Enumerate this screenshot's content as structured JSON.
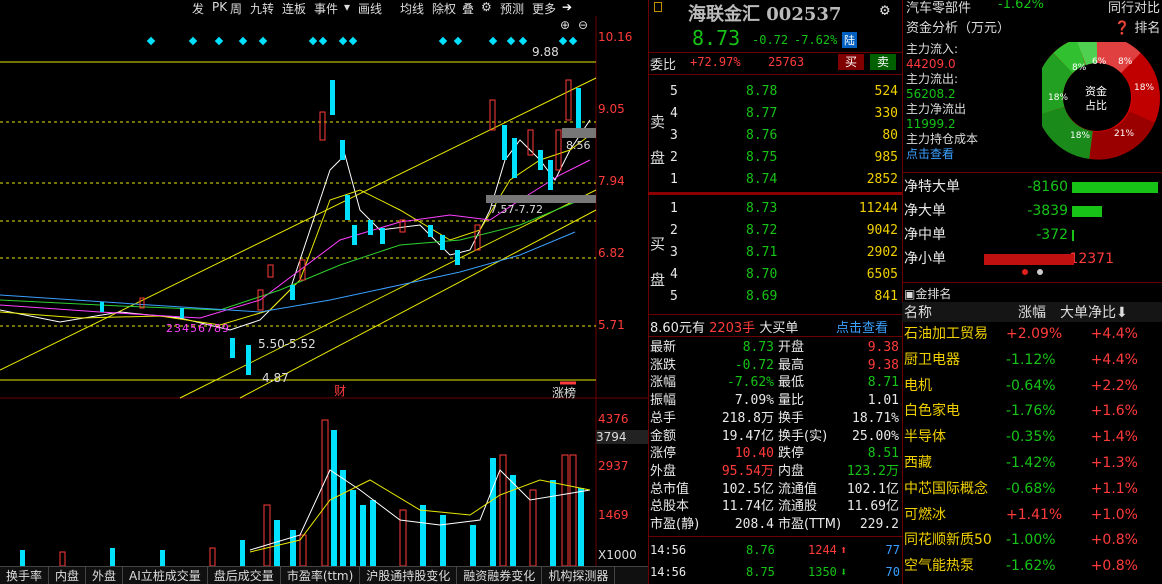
{
  "toolbar": {
    "items": [
      "发",
      "PK",
      "周",
      "九转",
      "连板",
      "事件",
      "▾",
      "画线",
      "均线",
      "除权",
      "叠",
      "⚙",
      "预测",
      "更多"
    ],
    "icons": [
      "back-icon",
      "plus-icon",
      "minus-icon"
    ]
  },
  "chart": {
    "price_labels": [
      "10.16",
      "9.05",
      "7.94",
      "6.82",
      "5.71"
    ],
    "marker_high": "9.88",
    "marker_low": "4.87",
    "annot_current": "8.56",
    "annot_range1": "7.57-7.72",
    "annot_range2": "5.50-5.52",
    "annot_fin": "财",
    "annot_zt": "涨榜",
    "seq": "23456789",
    "vol_labels": [
      "4376",
      "3794",
      "2937",
      "1469",
      "X1000"
    ]
  },
  "bottom_tabs": [
    "换手率",
    "内盘",
    "外盘",
    "AI立桩成交量",
    "盘后成交量",
    "市盈率(ttm)",
    "沪股通持股变化",
    "融资融券变化",
    "机构探测器"
  ],
  "quote": {
    "name": "海联金汇",
    "code": "002537",
    "price": "8.73",
    "change": "-0.72",
    "pct": "-7.62%",
    "board": "陆",
    "weibi_label": "委比",
    "weibi": "+72.97%",
    "weicha": "25763",
    "buy_btn": "买",
    "sell_btn": "卖",
    "sell_label": [
      "卖",
      "盘"
    ],
    "buy_label": [
      "买",
      "盘"
    ],
    "asks": [
      {
        "lv": "5",
        "p": "8.78",
        "v": "524"
      },
      {
        "lv": "4",
        "p": "8.77",
        "v": "330"
      },
      {
        "lv": "3",
        "p": "8.76",
        "v": "80"
      },
      {
        "lv": "2",
        "p": "8.75",
        "v": "985"
      },
      {
        "lv": "1",
        "p": "8.74",
        "v": "2852"
      }
    ],
    "bids": [
      {
        "lv": "1",
        "p": "8.73",
        "v": "11244"
      },
      {
        "lv": "2",
        "p": "8.72",
        "v": "9042"
      },
      {
        "lv": "3",
        "p": "8.71",
        "v": "2902"
      },
      {
        "lv": "4",
        "p": "8.70",
        "v": "6505"
      },
      {
        "lv": "5",
        "p": "8.69",
        "v": "841"
      }
    ],
    "bigorder": {
      "p": "8.60元有",
      "v": "2203手",
      "t": "大买单",
      "link": "点击查看"
    },
    "stats": [
      [
        "最新",
        "8.73",
        "开盘",
        "9.38"
      ],
      [
        "涨跌",
        "-0.72",
        "最高",
        "9.38"
      ],
      [
        "涨幅",
        "-7.62%",
        "最低",
        "8.71"
      ],
      [
        "振幅",
        "7.09%",
        "量比",
        "1.01"
      ],
      [
        "总手",
        "218.8万",
        "换手",
        "18.71%"
      ],
      [
        "金额",
        "19.47亿",
        "换手(实)",
        "25.00%"
      ],
      [
        "涨停",
        "10.40",
        "跌停",
        "8.51"
      ],
      [
        "外盘",
        "95.54万",
        "内盘",
        "123.2万"
      ],
      [
        "总市值",
        "102.5亿",
        "流通值",
        "102.1亿"
      ],
      [
        "总股本",
        "11.74亿",
        "流通股",
        "11.69亿"
      ],
      [
        "市盈(静)",
        "208.4",
        "市盈(TTM)",
        "229.2"
      ]
    ],
    "ticks": [
      {
        "t": "14:56",
        "p": "8.76",
        "v": "1244",
        "d": "77"
      },
      {
        "t": "14:56",
        "p": "8.75",
        "v": "1350",
        "d": "70"
      }
    ]
  },
  "right": {
    "top_sector": "汽车零部件",
    "top_pct": "-1.62%",
    "top_tab": "同行对比",
    "fund_title": "资金分析（万元）",
    "rank": "排名",
    "in_label": "主力流入:",
    "in_val": "44209.0",
    "out_label": "主力流出:",
    "out_val": "56208.2",
    "net_label": "主力净流出",
    "net_val": "11999.2",
    "hold_label": "主力持仓成本",
    "hold_link": "点击查看",
    "donut_center": [
      "资金",
      "占比"
    ],
    "donut_pcts": [
      "8%",
      "18%",
      "21%",
      "18%",
      "18%",
      "8%",
      "6%"
    ],
    "flows": [
      {
        "l": "净特大单",
        "v": "-8160"
      },
      {
        "l": "净大单",
        "v": "-3839"
      },
      {
        "l": "净中单",
        "v": "-372"
      },
      {
        "l": "净小单",
        "v": "12371"
      }
    ],
    "rank_title": "金排名",
    "col_name": "名称",
    "col_pct": "涨幅",
    "col_big": "大单净比",
    "sectors": [
      {
        "n": "石油加工贸易",
        "p": "+2.09%",
        "b": "+4.4%"
      },
      {
        "n": "厨卫电器",
        "p": "-1.12%",
        "b": "+4.4%"
      },
      {
        "n": "电机",
        "p": "-0.64%",
        "b": "+2.2%"
      },
      {
        "n": "白色家电",
        "p": "-1.76%",
        "b": "+1.6%"
      },
      {
        "n": "半导体",
        "p": "-0.35%",
        "b": "+1.4%"
      },
      {
        "n": "西藏",
        "p": "-1.42%",
        "b": "+1.3%"
      },
      {
        "n": "中芯国际概念",
        "p": "-0.68%",
        "b": "+1.1%"
      },
      {
        "n": "可燃冰",
        "p": "+1.41%",
        "b": "+1.0%"
      },
      {
        "n": "同花顺新质50",
        "p": "-1.00%",
        "b": "+0.8%"
      },
      {
        "n": "空气能热泵",
        "p": "-1.62%",
        "b": "+0.8%"
      }
    ]
  }
}
